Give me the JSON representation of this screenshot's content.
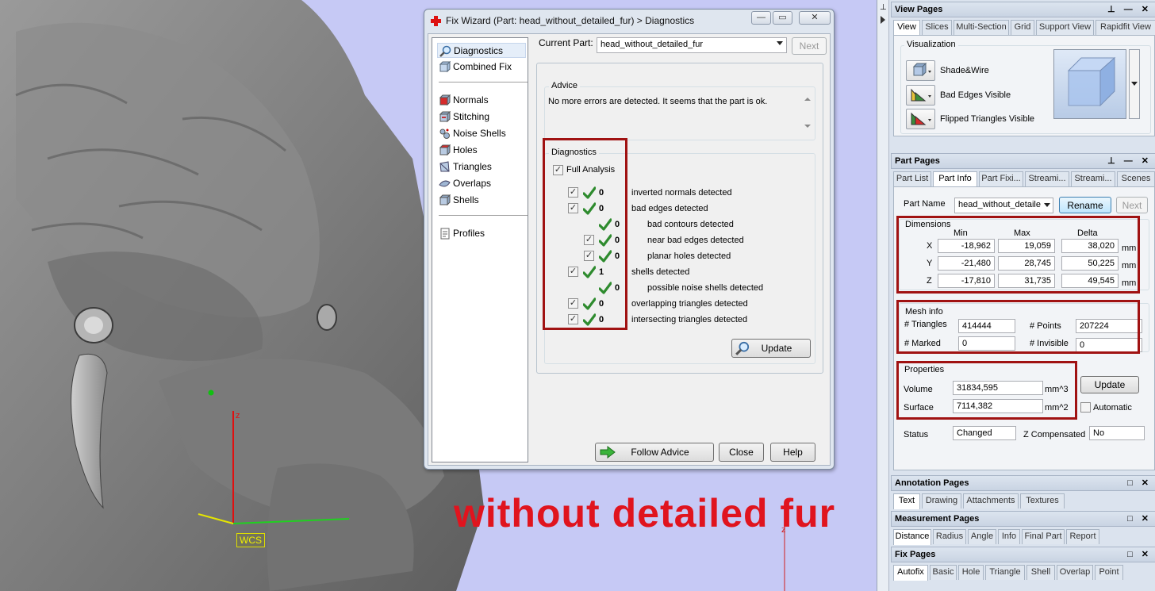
{
  "overlay_caption": "without detailed fur",
  "viewport": {
    "axis_z": "z",
    "wcs_label": "WCS",
    "axis_z2": "z"
  },
  "wizard": {
    "title": "Fix Wizard (Part: head_without_detailed_fur) > Diagnostics",
    "window_buttons": {
      "minimize": "—",
      "restore": "▭",
      "close": "✕"
    },
    "nav": [
      {
        "label": "Diagnostics",
        "icon": "magnifier-icon",
        "selected": true
      },
      {
        "label": "Combined Fix",
        "icon": "cube-icon"
      },
      {
        "label": "Normals",
        "icon": "normals-icon"
      },
      {
        "label": "Stitching",
        "icon": "stitching-icon"
      },
      {
        "label": "Noise Shells",
        "icon": "noise-shells-icon"
      },
      {
        "label": "Holes",
        "icon": "holes-icon"
      },
      {
        "label": "Triangles",
        "icon": "triangles-icon"
      },
      {
        "label": "Overlaps",
        "icon": "overlaps-icon"
      },
      {
        "label": "Shells",
        "icon": "shells-icon"
      },
      {
        "label": "Profiles",
        "icon": "profiles-icon"
      }
    ],
    "current_part_label": "Current Part:",
    "current_part_value": "head_without_detailed_fur",
    "next_label": "Next",
    "advice_title": "Advice",
    "advice_text": "No more errors are detected. It seems that the part is ok.",
    "diagnostics_title": "Diagnostics",
    "full_analysis_label": "Full Analysis",
    "diagnostics": [
      {
        "count": "0",
        "label": "inverted normals detected",
        "checkbox": true,
        "indent": 0
      },
      {
        "count": "0",
        "label": "bad edges detected",
        "checkbox": true,
        "indent": 0
      },
      {
        "count": "0",
        "label": "bad contours detected",
        "checkbox": false,
        "indent": 1
      },
      {
        "count": "0",
        "label": "near bad edges detected",
        "checkbox": true,
        "indent": 1
      },
      {
        "count": "0",
        "label": "planar holes detected",
        "checkbox": true,
        "indent": 1
      },
      {
        "count": "1",
        "label": "shells detected",
        "checkbox": true,
        "indent": 0
      },
      {
        "count": "0",
        "label": "possible noise shells detected",
        "checkbox": false,
        "indent": 1
      },
      {
        "count": "0",
        "label": "overlapping triangles detected",
        "checkbox": true,
        "indent": 0
      },
      {
        "count": "0",
        "label": "intersecting triangles detected",
        "checkbox": true,
        "indent": 0
      }
    ],
    "update_label": "Update",
    "follow_advice_label": "Follow Advice",
    "close_label": "Close",
    "help_label": "Help"
  },
  "view_pages": {
    "title": "View Pages",
    "tabs": [
      "View",
      "Slices",
      "Multi-Section",
      "Grid",
      "Support View",
      "Rapidfit View"
    ],
    "visualization_title": "Visualization",
    "options": [
      "Shade&Wire",
      "Bad Edges Visible",
      "Flipped Triangles Visible"
    ]
  },
  "part_pages": {
    "title": "Part Pages",
    "tabs": [
      "Part List",
      "Part Info",
      "Part Fixi...",
      "Streami...",
      "Streami...",
      "Scenes"
    ],
    "part_name_label": "Part Name",
    "part_name_value": "head_without_detaile",
    "rename_label": "Rename",
    "next_label": "Next",
    "dimensions": {
      "title": "Dimensions",
      "headers": [
        "Min",
        "Max",
        "Delta"
      ],
      "rows": [
        {
          "axis": "X",
          "min": "-18,962",
          "max": "19,059",
          "delta": "38,020",
          "unit": "mm"
        },
        {
          "axis": "Y",
          "min": "-21,480",
          "max": "28,745",
          "delta": "50,225",
          "unit": "mm"
        },
        {
          "axis": "Z",
          "min": "-17,810",
          "max": "31,735",
          "delta": "49,545",
          "unit": "mm"
        }
      ]
    },
    "mesh_info": {
      "title": "Mesh info",
      "triangles_label": "# Triangles",
      "triangles": "414444",
      "points_label": "# Points",
      "points": "207224",
      "marked_label": "# Marked",
      "marked": "0",
      "invisible_label": "# Invisible",
      "invisible": "0"
    },
    "properties": {
      "title": "Properties",
      "volume_label": "Volume",
      "volume": "31834,595",
      "volume_unit": "mm^3",
      "surface_label": "Surface",
      "surface": "7114,382",
      "surface_unit": "mm^2",
      "update_label": "Update",
      "automatic_label": "Automatic"
    },
    "status_label": "Status",
    "status_value": "Changed",
    "zcomp_label": "Z Compensated",
    "zcomp_value": "No"
  },
  "annotation_pages": {
    "title": "Annotation Pages",
    "tabs": [
      "Text",
      "Drawing",
      "Attachments",
      "Textures"
    ]
  },
  "measurement_pages": {
    "title": "Measurement Pages",
    "tabs": [
      "Distance",
      "Radius",
      "Angle",
      "Info",
      "Final Part",
      "Report"
    ]
  },
  "fix_pages": {
    "title": "Fix Pages",
    "tabs": [
      "Autofix",
      "Basic",
      "Hole",
      "Triangle",
      "Shell",
      "Overlap",
      "Point"
    ]
  },
  "colors": {
    "viewport_bg": "#c6c9f5",
    "highlight_box": "#a01212",
    "caption": "#e0141e",
    "check": "#2e8b2e"
  }
}
